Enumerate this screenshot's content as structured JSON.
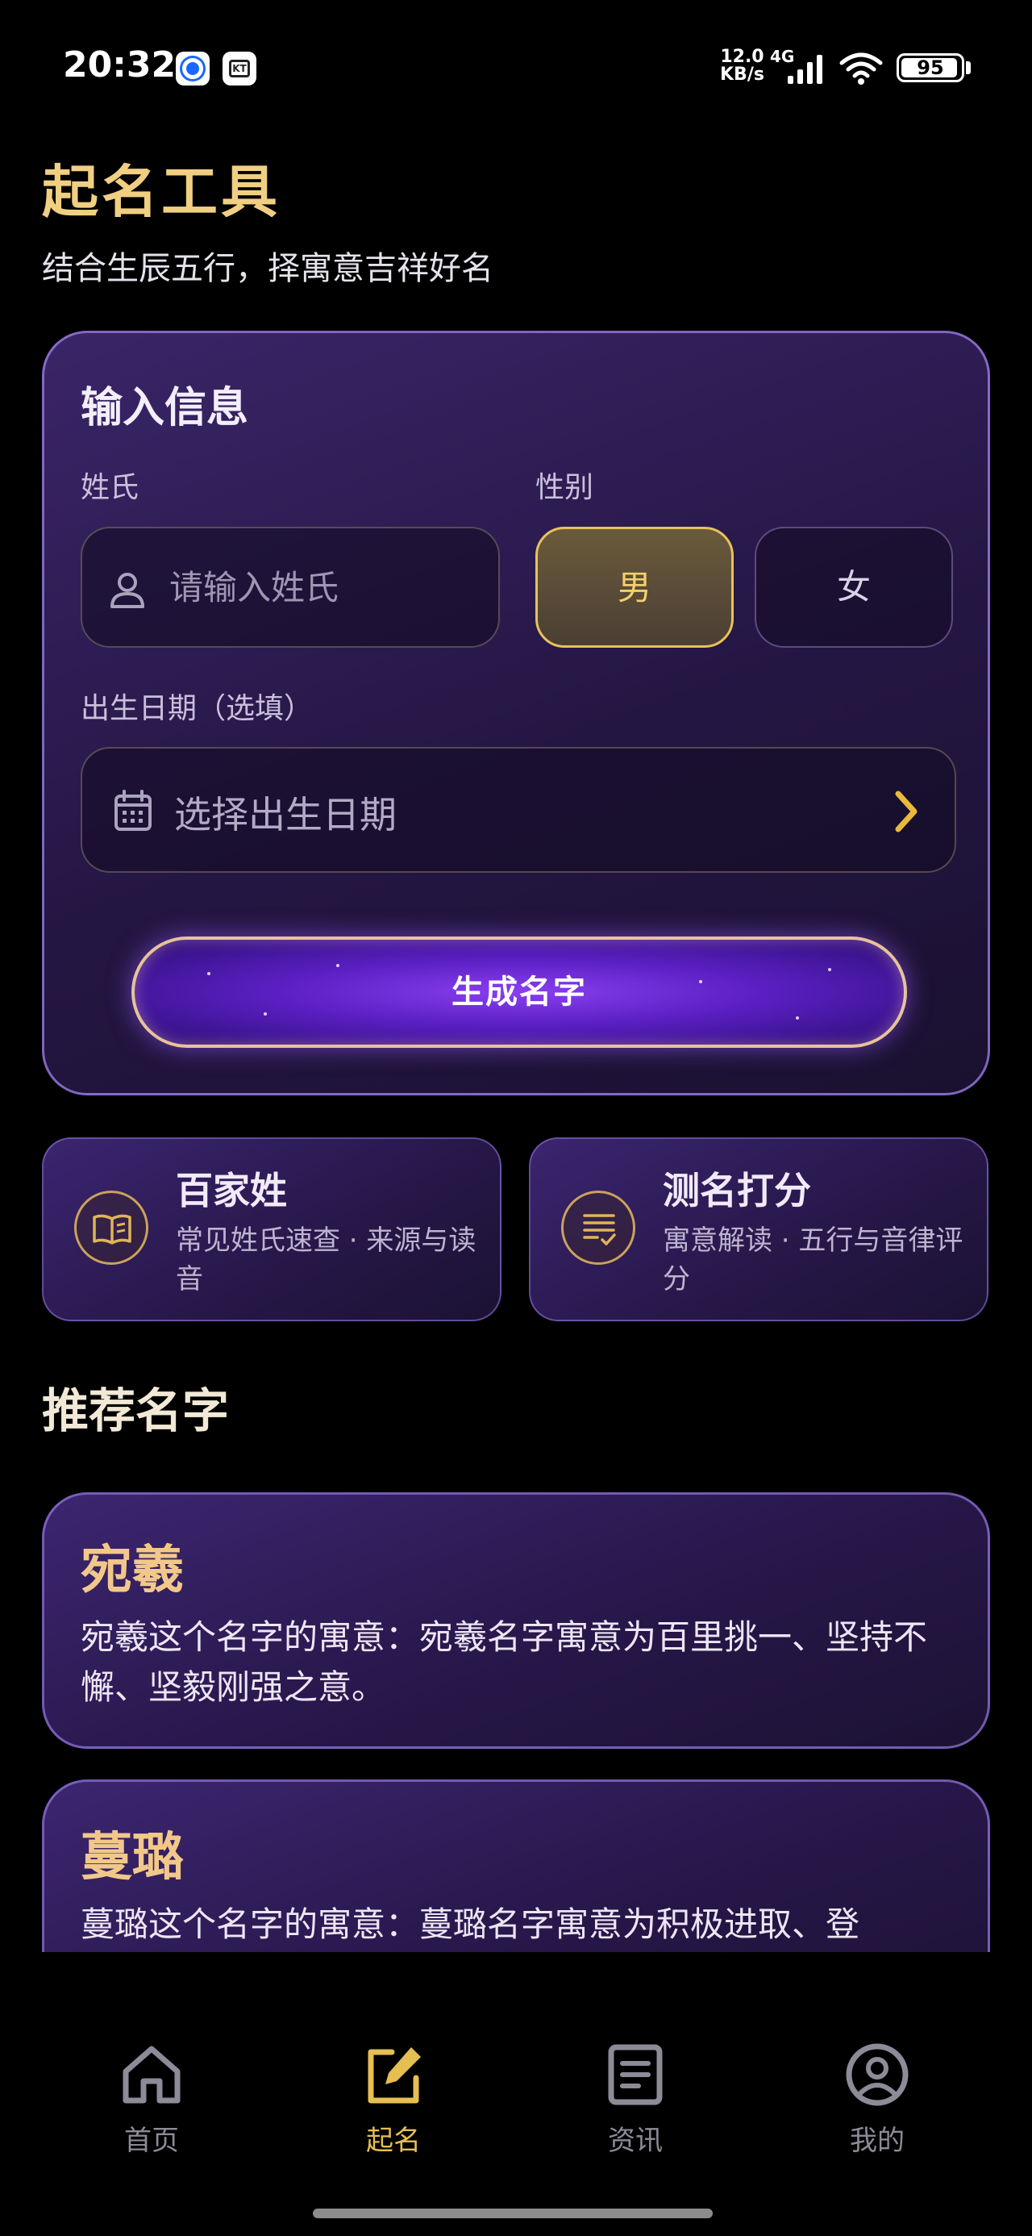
{
  "status_bar": {
    "time": "20:32",
    "net_speed_value": "12.0",
    "net_speed_unit": "KB/s",
    "network": "4G",
    "battery": "95",
    "app_icons": [
      "browser-icon",
      "media-icon"
    ]
  },
  "header": {
    "title": "起名工具",
    "subtitle": "结合生辰五行，择寓意吉祥好名"
  },
  "form": {
    "title": "输入信息",
    "surname_label": "姓氏",
    "surname_placeholder": "请输入姓氏",
    "gender_label": "性别",
    "gender_options": [
      "男",
      "女"
    ],
    "gender_selected": "男",
    "birth_label": "出生日期（选填）",
    "birth_placeholder": "选择出生日期",
    "submit_label": "生成名字"
  },
  "features": [
    {
      "title": "百家姓",
      "desc": "常见姓氏速查 · 来源与读音",
      "icon": "book-icon"
    },
    {
      "title": "测名打分",
      "desc": "寓意解读 · 五行与音律评分",
      "icon": "score-list-icon"
    }
  ],
  "recommend": {
    "title": "推荐名字",
    "names": [
      {
        "name": "宛羲",
        "desc": "宛羲这个名字的寓意：宛羲名字寓意为百里挑一、坚持不懈、坚毅刚强之意。"
      },
      {
        "name": "蔓璐",
        "desc": "蔓璐这个名字的寓意：蔓璐名字寓意为积极进取、登"
      }
    ]
  },
  "bottom_nav": {
    "items": [
      {
        "label": "首页",
        "icon": "home-icon"
      },
      {
        "label": "起名",
        "icon": "edit-icon"
      },
      {
        "label": "资讯",
        "icon": "news-icon"
      },
      {
        "label": "我的",
        "icon": "profile-icon"
      }
    ],
    "active": "起名"
  },
  "colors": {
    "accent_gold": "#f1cf82",
    "nav_active": "#e6bf52",
    "card_border": "#a082eb",
    "background": "#000000"
  }
}
